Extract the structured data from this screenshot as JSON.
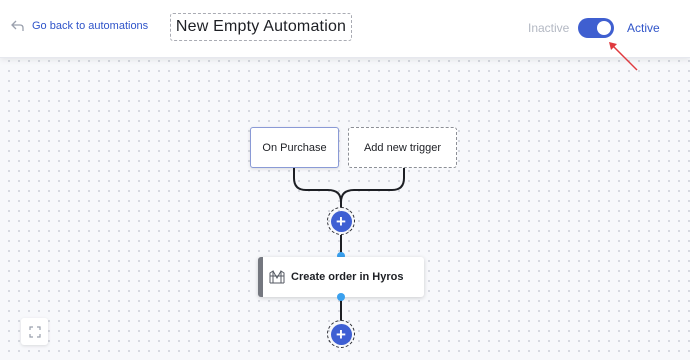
{
  "header": {
    "back_label": "Go back to automations",
    "title": "New Empty Automation",
    "inactive_label": "Inactive",
    "active_label": "Active",
    "toggle_state": "active"
  },
  "flow": {
    "triggers": [
      {
        "label": "On Purchase"
      },
      {
        "label": "Add new trigger"
      }
    ],
    "action": {
      "label": "Create order in Hyros",
      "icon": "bridge-icon"
    }
  },
  "colors": {
    "accent": "#3e5fd3",
    "link": "#2f54c9",
    "connector_dot": "#3aa0ee",
    "annotation_arrow": "#e0393e"
  }
}
